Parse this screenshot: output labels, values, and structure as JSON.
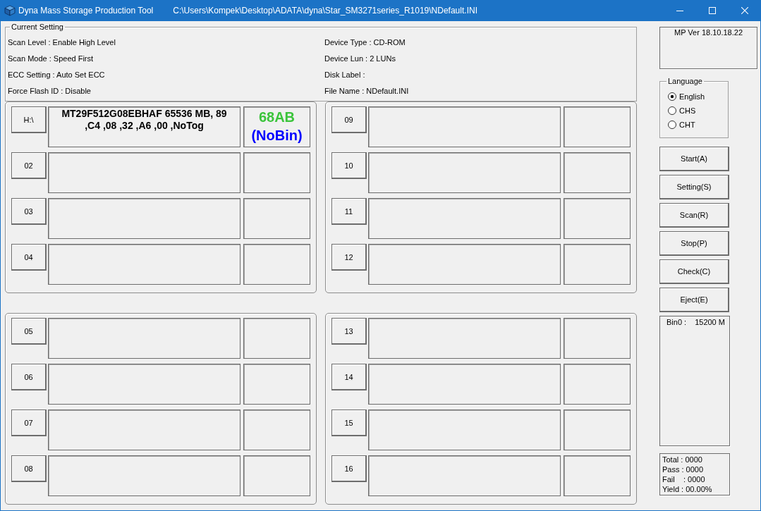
{
  "window": {
    "title": "Dyna Mass Storage Production Tool",
    "path": "C:\\Users\\Kompek\\Desktop\\ADATA\\dyna\\Star_SM3271series_R1019\\NDefault.INI"
  },
  "current_setting": {
    "title": "Current Setting",
    "left": [
      "Scan Level : Enable High Level",
      "Scan Mode : Speed First",
      "ECC Setting : Auto Set ECC",
      "Force Flash ID : Disable"
    ],
    "right": [
      "Device Type : CD-ROM",
      "Device Lun : 2 LUNs",
      "Disk Label :",
      "File Name : NDefault.INI"
    ]
  },
  "port_groups": [
    {
      "ports": [
        {
          "label": "H:\\",
          "info": "MT29F512G08EBHAF 65536 MB, 89 ,C4 ,08 ,32 ,A6 ,00 ,NoTog",
          "status": [
            {
              "text": "68AB",
              "color": "#3cc43c"
            },
            {
              "text": "(NoBin)",
              "color": "#0000ff"
            }
          ]
        },
        {
          "label": "02"
        },
        {
          "label": "03"
        },
        {
          "label": "04"
        }
      ]
    },
    {
      "ports": [
        {
          "label": "09"
        },
        {
          "label": "10"
        },
        {
          "label": "11"
        },
        {
          "label": "12"
        }
      ]
    },
    {
      "ports": [
        {
          "label": "05"
        },
        {
          "label": "06"
        },
        {
          "label": "07"
        },
        {
          "label": "08"
        }
      ]
    },
    {
      "ports": [
        {
          "label": "13"
        },
        {
          "label": "14"
        },
        {
          "label": "15"
        },
        {
          "label": "16"
        }
      ]
    }
  ],
  "version": "MP Ver 18.10.18.22",
  "language": {
    "title": "Language",
    "options": [
      {
        "label": "English",
        "selected": true
      },
      {
        "label": "CHS",
        "selected": false
      },
      {
        "label": "CHT",
        "selected": false
      }
    ]
  },
  "buttons": [
    "Start(A)",
    "Setting(S)",
    "Scan(R)",
    "Stop(P)",
    "Check(C)",
    "Eject(E)"
  ],
  "bins": [
    {
      "label": "Bin0 :",
      "value": "15200 M"
    }
  ],
  "stats": [
    "Total : 0000",
    "Pass : 0000",
    "Fail    : 0000",
    "Yield : 00.00%"
  ]
}
